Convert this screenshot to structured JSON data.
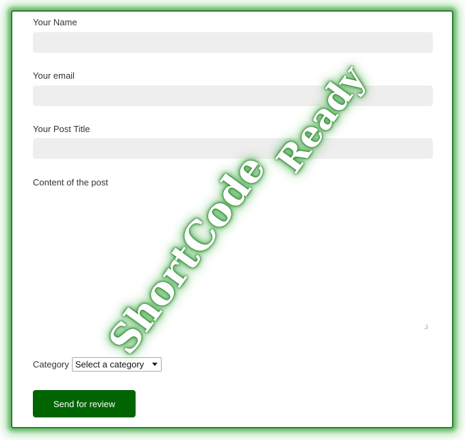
{
  "form": {
    "name_label": "Your Name",
    "name_value": "",
    "email_label": "Your email",
    "email_value": "",
    "post_title_label": "Your Post Title",
    "post_title_value": "",
    "content_label": "Content of the post",
    "content_value": "",
    "category_label": "Category",
    "category_selected": "Select a category",
    "submit_label": "Send for review"
  },
  "watermark": {
    "line1": "ShortCode",
    "line2": "Ready"
  },
  "colors": {
    "accent": "#006400",
    "field_bg": "#eeeeee",
    "glow": "#4caf50"
  },
  "icons": {
    "select_arrow": "chevron-down-icon",
    "resize": "resize-grip-icon"
  }
}
